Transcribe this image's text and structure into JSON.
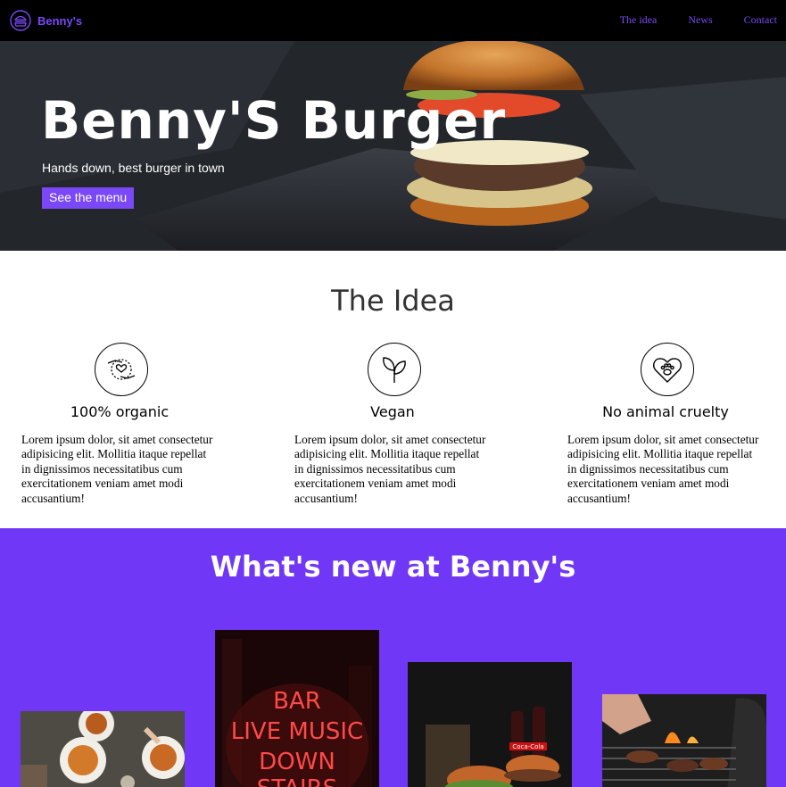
{
  "nav": {
    "brand": "Benny's",
    "links": [
      "The idea",
      "News",
      "Contact"
    ]
  },
  "hero": {
    "title": "Benny'S Burger",
    "subtitle": "Hands down, best burger in town",
    "cta": "See the menu"
  },
  "idea": {
    "title": "The Idea",
    "features": [
      {
        "icon": "hands-heart-icon",
        "heading": "100% organic",
        "text": "Lorem ipsum dolor, sit amet consectetur adipisicing elit. Mollitia itaque repellat in dignissimos necessitatibus cum exercitationem veniam amet modi accusantium!"
      },
      {
        "icon": "leaf-sprout-icon",
        "heading": "Vegan",
        "text": "Lorem ipsum dolor, sit amet consectetur adipisicing elit. Mollitia itaque repellat in dignissimos necessitatibus cum exercitationem veniam amet modi accusantium!"
      },
      {
        "icon": "heart-paw-icon",
        "heading": "No animal cruelty",
        "text": "Lorem ipsum dolor, sit amet consectetur adipisicing elit. Mollitia itaque repellat in dignissimos necessitatibus cum exercitationem veniam amet modi accusantium!"
      }
    ]
  },
  "news": {
    "title": "What's new at Benny's",
    "cards": [
      {
        "image": "food-table-photo"
      },
      {
        "image": "neon-sign-photo",
        "sign": [
          "BAR",
          "LIVE MUSIC",
          "DOWN",
          "STAIRS"
        ]
      },
      {
        "image": "burgers-drinks-photo",
        "bottle_label": "Coca-Cola"
      },
      {
        "image": "grill-photo"
      }
    ]
  },
  "colors": {
    "accent": "#7b48f7",
    "news_bg": "#7038f6",
    "nav_bg": "#000000"
  }
}
